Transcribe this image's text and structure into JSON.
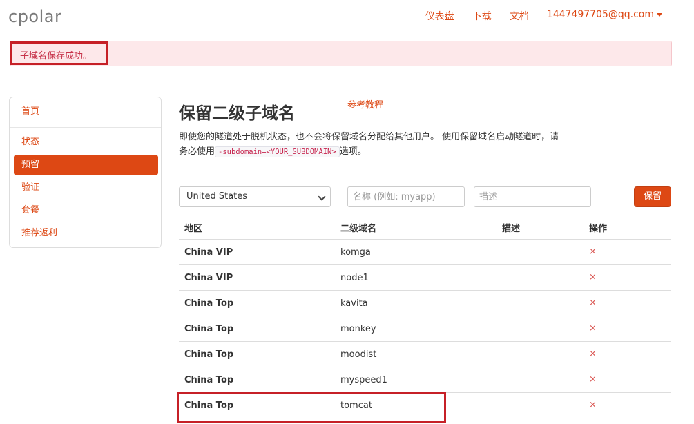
{
  "brand": "cpolar",
  "nav": {
    "dashboard": "仪表盘",
    "download": "下载",
    "docs": "文档",
    "account": "1447497705@qq.com"
  },
  "alert": {
    "message": "子域名保存成功。"
  },
  "sidebar": {
    "items": [
      {
        "label": "首页"
      },
      {
        "label": "状态"
      },
      {
        "label": "预留",
        "active": true
      },
      {
        "label": "验证"
      },
      {
        "label": "套餐"
      },
      {
        "label": "推荐返利"
      }
    ]
  },
  "main": {
    "title": "保留二级子域名",
    "ref_link": "参考教程",
    "desc_part1": "即使您的隧道处于脱机状态，也不会将保留域名分配给其他用户。 使用保留域名启动隧道时，请务必使用",
    "desc_code": "-subdomain=<YOUR_SUBDOMAIN>",
    "desc_part2": "选项。"
  },
  "form": {
    "region_selected": "United States",
    "name_placeholder": "名称 (例如: myapp)",
    "desc_placeholder": "描述",
    "submit": "保留"
  },
  "table": {
    "headers": {
      "region": "地区",
      "subdomain": "二级域名",
      "desc": "描述",
      "action": "操作"
    },
    "delete_glyph": "×",
    "rows": [
      {
        "region": "China VIP",
        "subdomain": "komga",
        "desc": ""
      },
      {
        "region": "China VIP",
        "subdomain": "node1",
        "desc": ""
      },
      {
        "region": "China Top",
        "subdomain": "kavita",
        "desc": ""
      },
      {
        "region": "China Top",
        "subdomain": "monkey",
        "desc": ""
      },
      {
        "region": "China Top",
        "subdomain": "moodist",
        "desc": ""
      },
      {
        "region": "China Top",
        "subdomain": "myspeed1",
        "desc": ""
      },
      {
        "region": "China Top",
        "subdomain": "tomcat",
        "desc": ""
      }
    ]
  },
  "colors": {
    "accent": "#dd4814",
    "alert_bg": "#fde8ea",
    "alert_text": "#c7334a",
    "highlight_border": "#c62027",
    "delete": "#d9534f"
  }
}
